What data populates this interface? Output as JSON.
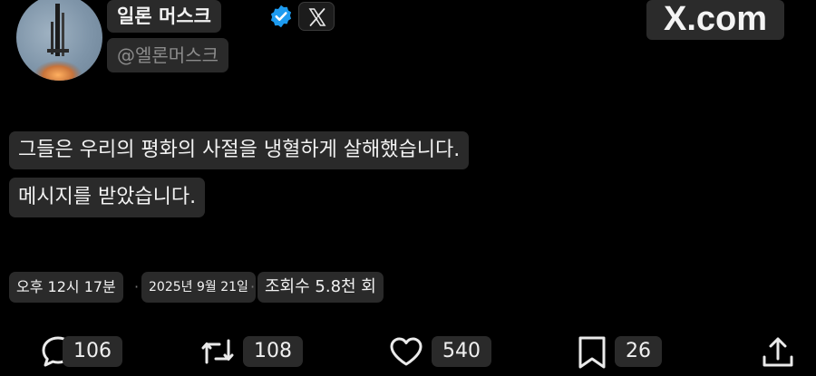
{
  "author": {
    "name": "일론 머스크",
    "handle": "@엘론머스크",
    "verified_color": "#1d9bf0"
  },
  "brand": {
    "label": "X.com"
  },
  "tweet": {
    "lines": [
      "그들은 우리의 평화의 사절을 냉혈하게 살해했습니다.",
      "메시지를 받았습니다."
    ]
  },
  "meta": {
    "time": "오후 12시 17분",
    "separator": "·",
    "date": "2025년 9월 21일",
    "views": "조회수 5.8천 회"
  },
  "actions": {
    "replies": "106",
    "reposts": "108",
    "likes": "540",
    "bookmarks": "26"
  },
  "icons": [
    "verified-badge-icon",
    "x-logo-icon",
    "reply-icon",
    "repost-icon",
    "heart-icon",
    "bookmark-icon",
    "share-icon"
  ]
}
